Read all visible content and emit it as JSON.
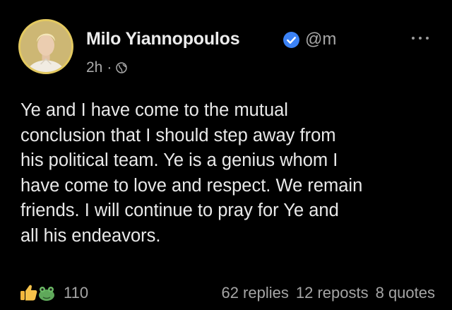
{
  "post": {
    "author_name": "Milo Yiannopoulos",
    "handle": "@m",
    "timestamp": "2h",
    "separator": "·",
    "visibility_icon": "globe-icon",
    "body": "Ye and I have come to the mutual\nconclusion that I should step away from\nhis political team. Ye is a genius whom I\nhave come to love and respect. We remain\nfriends. I will continue to pray for Ye and\nall his endeavors.",
    "reaction_count": "110",
    "replies": "62 replies",
    "reposts": "12 reposts",
    "quotes": "8 quotes"
  },
  "colors": {
    "background": "#000000",
    "verified": "#3b82f6",
    "text": "#e9e9e9",
    "muted": "#a5a5a5"
  }
}
